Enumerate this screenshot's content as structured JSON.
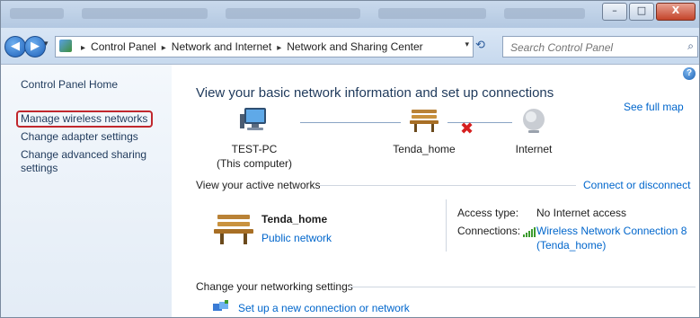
{
  "window": {
    "controls": {
      "minimize": "–",
      "maximize": "□",
      "close": "X"
    }
  },
  "address_bar": {
    "breadcrumbs": [
      "Control Panel",
      "Network and Internet",
      "Network and Sharing Center"
    ],
    "separator": "▸",
    "dropdown_arrow": "▾",
    "refresh_icon": "⟲",
    "search_placeholder": "Search Control Panel",
    "search_icon": "⌕"
  },
  "sidebar": {
    "items": [
      {
        "label": "Control Panel Home"
      },
      {
        "label": "Manage wireless networks",
        "highlighted": true
      },
      {
        "label": "Change adapter settings"
      },
      {
        "label": "Change advanced sharing settings"
      }
    ]
  },
  "main": {
    "heading": "View your basic network information and set up connections",
    "see_full_map": "See full map",
    "map": {
      "computer_name": "TEST-PC",
      "computer_sub": "(This computer)",
      "network_name": "Tenda_home",
      "internet_label": "Internet",
      "broken_link": "✖"
    },
    "active_networks": {
      "title": "View your active networks",
      "connect_link": "Connect or disconnect",
      "network_name": "Tenda_home",
      "network_category": "Public network",
      "access_type_label": "Access type:",
      "access_type_value": "No Internet access",
      "connections_label": "Connections:",
      "connection_name_line1": "Wireless Network Connection 8",
      "connection_name_line2": "(Tenda_home)"
    },
    "settings": {
      "title": "Change your networking settings",
      "new_connection": "Set up a new connection or network"
    }
  },
  "help_icon": "?",
  "colors": {
    "link": "#0066cc",
    "heading": "#1e395b",
    "highlight_border": "#c0272d",
    "error_x": "#d62020",
    "signal_green": "#3c9b2e"
  }
}
